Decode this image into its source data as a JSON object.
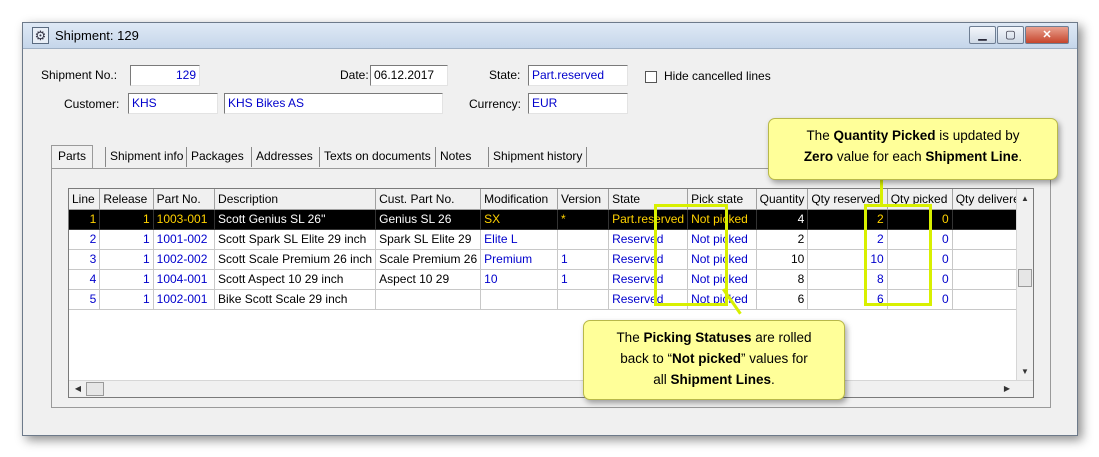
{
  "window": {
    "title": "Shipment: 129",
    "icon": "shipment-window-icon",
    "buttons": [
      "minimize",
      "maximize",
      "close"
    ]
  },
  "header": {
    "shipment_no_label": "Shipment No.:",
    "shipment_no": "129",
    "date_label": "Date:",
    "date": "06.12.2017",
    "state_label": "State:",
    "state": "Part.reserved",
    "hide_cancelled_label": "Hide cancelled lines",
    "hide_cancelled_checked": false,
    "customer_label": "Customer:",
    "customer_code": "KHS",
    "customer_name": "KHS Bikes AS",
    "currency_label": "Currency:",
    "currency": "EUR"
  },
  "tabs": [
    {
      "label": "Parts",
      "active": true
    },
    {
      "label": "Shipment info"
    },
    {
      "label": "Packages"
    },
    {
      "label": "Addresses"
    },
    {
      "label": "Texts on documents"
    },
    {
      "label": "Notes"
    },
    {
      "label": "Shipment history"
    }
  ],
  "grid": {
    "columns": [
      "Line",
      "Release",
      "Part No.",
      "Description",
      "Cust. Part No.",
      "Modification",
      "Version",
      "State",
      "Pick state",
      "Quantity",
      "Qty reserved",
      "Qty picked",
      "Qty delivered"
    ],
    "rows": [
      {
        "line": "1",
        "release": "1",
        "part_no": "1003-001",
        "description": "Scott Genius SL 26''",
        "cust_part_no": "Genius SL 26",
        "modification": "SX",
        "version": "*",
        "state": "Part.reserved",
        "pick_state": "Not picked",
        "quantity": "4",
        "qty_reserved": "2",
        "qty_picked": "0",
        "qty_delivered": "",
        "selected": true
      },
      {
        "line": "2",
        "release": "1",
        "part_no": "1001-002",
        "description": "Scott Spark SL Elite 29 inch",
        "cust_part_no": "Spark SL Elite 29",
        "modification": "Elite L",
        "version": "",
        "state": "Reserved",
        "pick_state": "Not picked",
        "quantity": "2",
        "qty_reserved": "2",
        "qty_picked": "0",
        "qty_delivered": ""
      },
      {
        "line": "3",
        "release": "1",
        "part_no": "1002-002",
        "description": "Scott Scale Premium 26 inch",
        "cust_part_no": "Scale Premium 26",
        "modification": "Premium",
        "version": "1",
        "state": "Reserved",
        "pick_state": "Not picked",
        "quantity": "10",
        "qty_reserved": "10",
        "qty_picked": "0",
        "qty_delivered": ""
      },
      {
        "line": "4",
        "release": "1",
        "part_no": "1004-001",
        "description": "Scott Aspect 10 29 inch",
        "cust_part_no": "Aspect 10 29",
        "modification": "10",
        "version": "1",
        "state": "Reserved",
        "pick_state": "Not picked",
        "quantity": "8",
        "qty_reserved": "8",
        "qty_picked": "0",
        "qty_delivered": ""
      },
      {
        "line": "5",
        "release": "1",
        "part_no": "1002-001",
        "description": "Bike Scott Scale 29 inch",
        "cust_part_no": "",
        "modification": "",
        "version": "",
        "state": "Reserved",
        "pick_state": "Not picked",
        "quantity": "6",
        "qty_reserved": "6",
        "qty_picked": "0",
        "qty_delivered": ""
      }
    ]
  },
  "callouts": {
    "qty_picked": {
      "t1": "The ",
      "b1": "Quantity Picked",
      "t2": " is updated by",
      "b2": "Zero",
      "t3": " value for each ",
      "b3": "Shipment Line",
      "t4": "."
    },
    "pick_status": {
      "t1": "The ",
      "b1": "Picking Statuses",
      "t2": " are rolled",
      "t3": "back to “",
      "b2": "Not picked",
      "t4": "” values for",
      "t5": "all ",
      "b3": "Shipment Lines",
      "t6": "."
    }
  },
  "colors": {
    "highlight": "#d8f000",
    "callout_bg": "#ffff99",
    "selected_row_bg": "#000000",
    "selected_row_text": "#ffd200",
    "value_text": "#0000cc"
  }
}
